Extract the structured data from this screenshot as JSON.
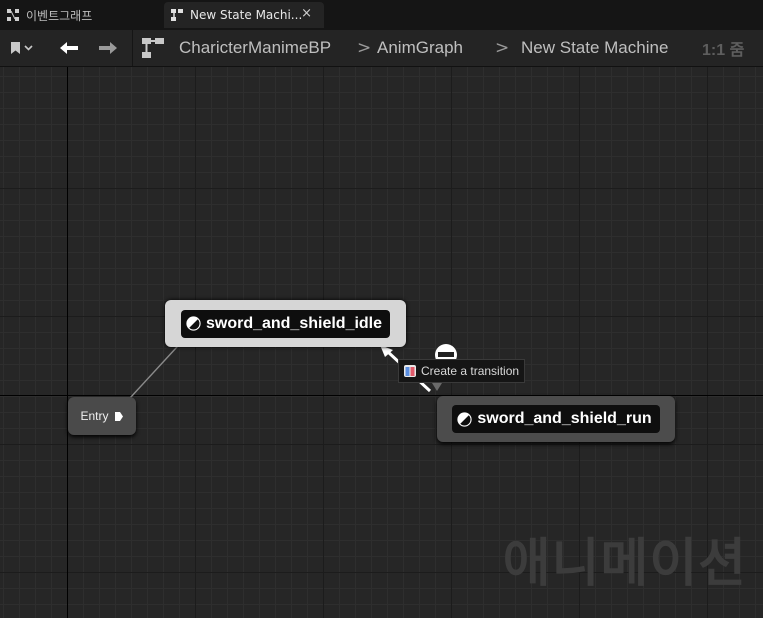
{
  "tabs": [
    {
      "label": "이벤트그래프",
      "icon": "event-graph-icon",
      "active": false
    },
    {
      "label": "New State Machi...",
      "icon": "state-machine-icon",
      "active": true,
      "close": "×"
    }
  ],
  "toolbar": {
    "breadcrumb": [
      "CharicterManimeBP",
      "AnimGraph",
      "New State Machine"
    ],
    "separator": ">",
    "zoom": "1:1 줌"
  },
  "graph": {
    "watermark": "애니메이션",
    "entry_label": "Entry",
    "states": {
      "idle": "sword_and_shield_idle",
      "run": "sword_and_shield_run"
    },
    "tooltip": "Create a transition"
  },
  "colors": {
    "background": "#262626",
    "node_selected": "#d6d6d6",
    "node": "#4c4c4c",
    "entry": "#4a4a4a"
  }
}
